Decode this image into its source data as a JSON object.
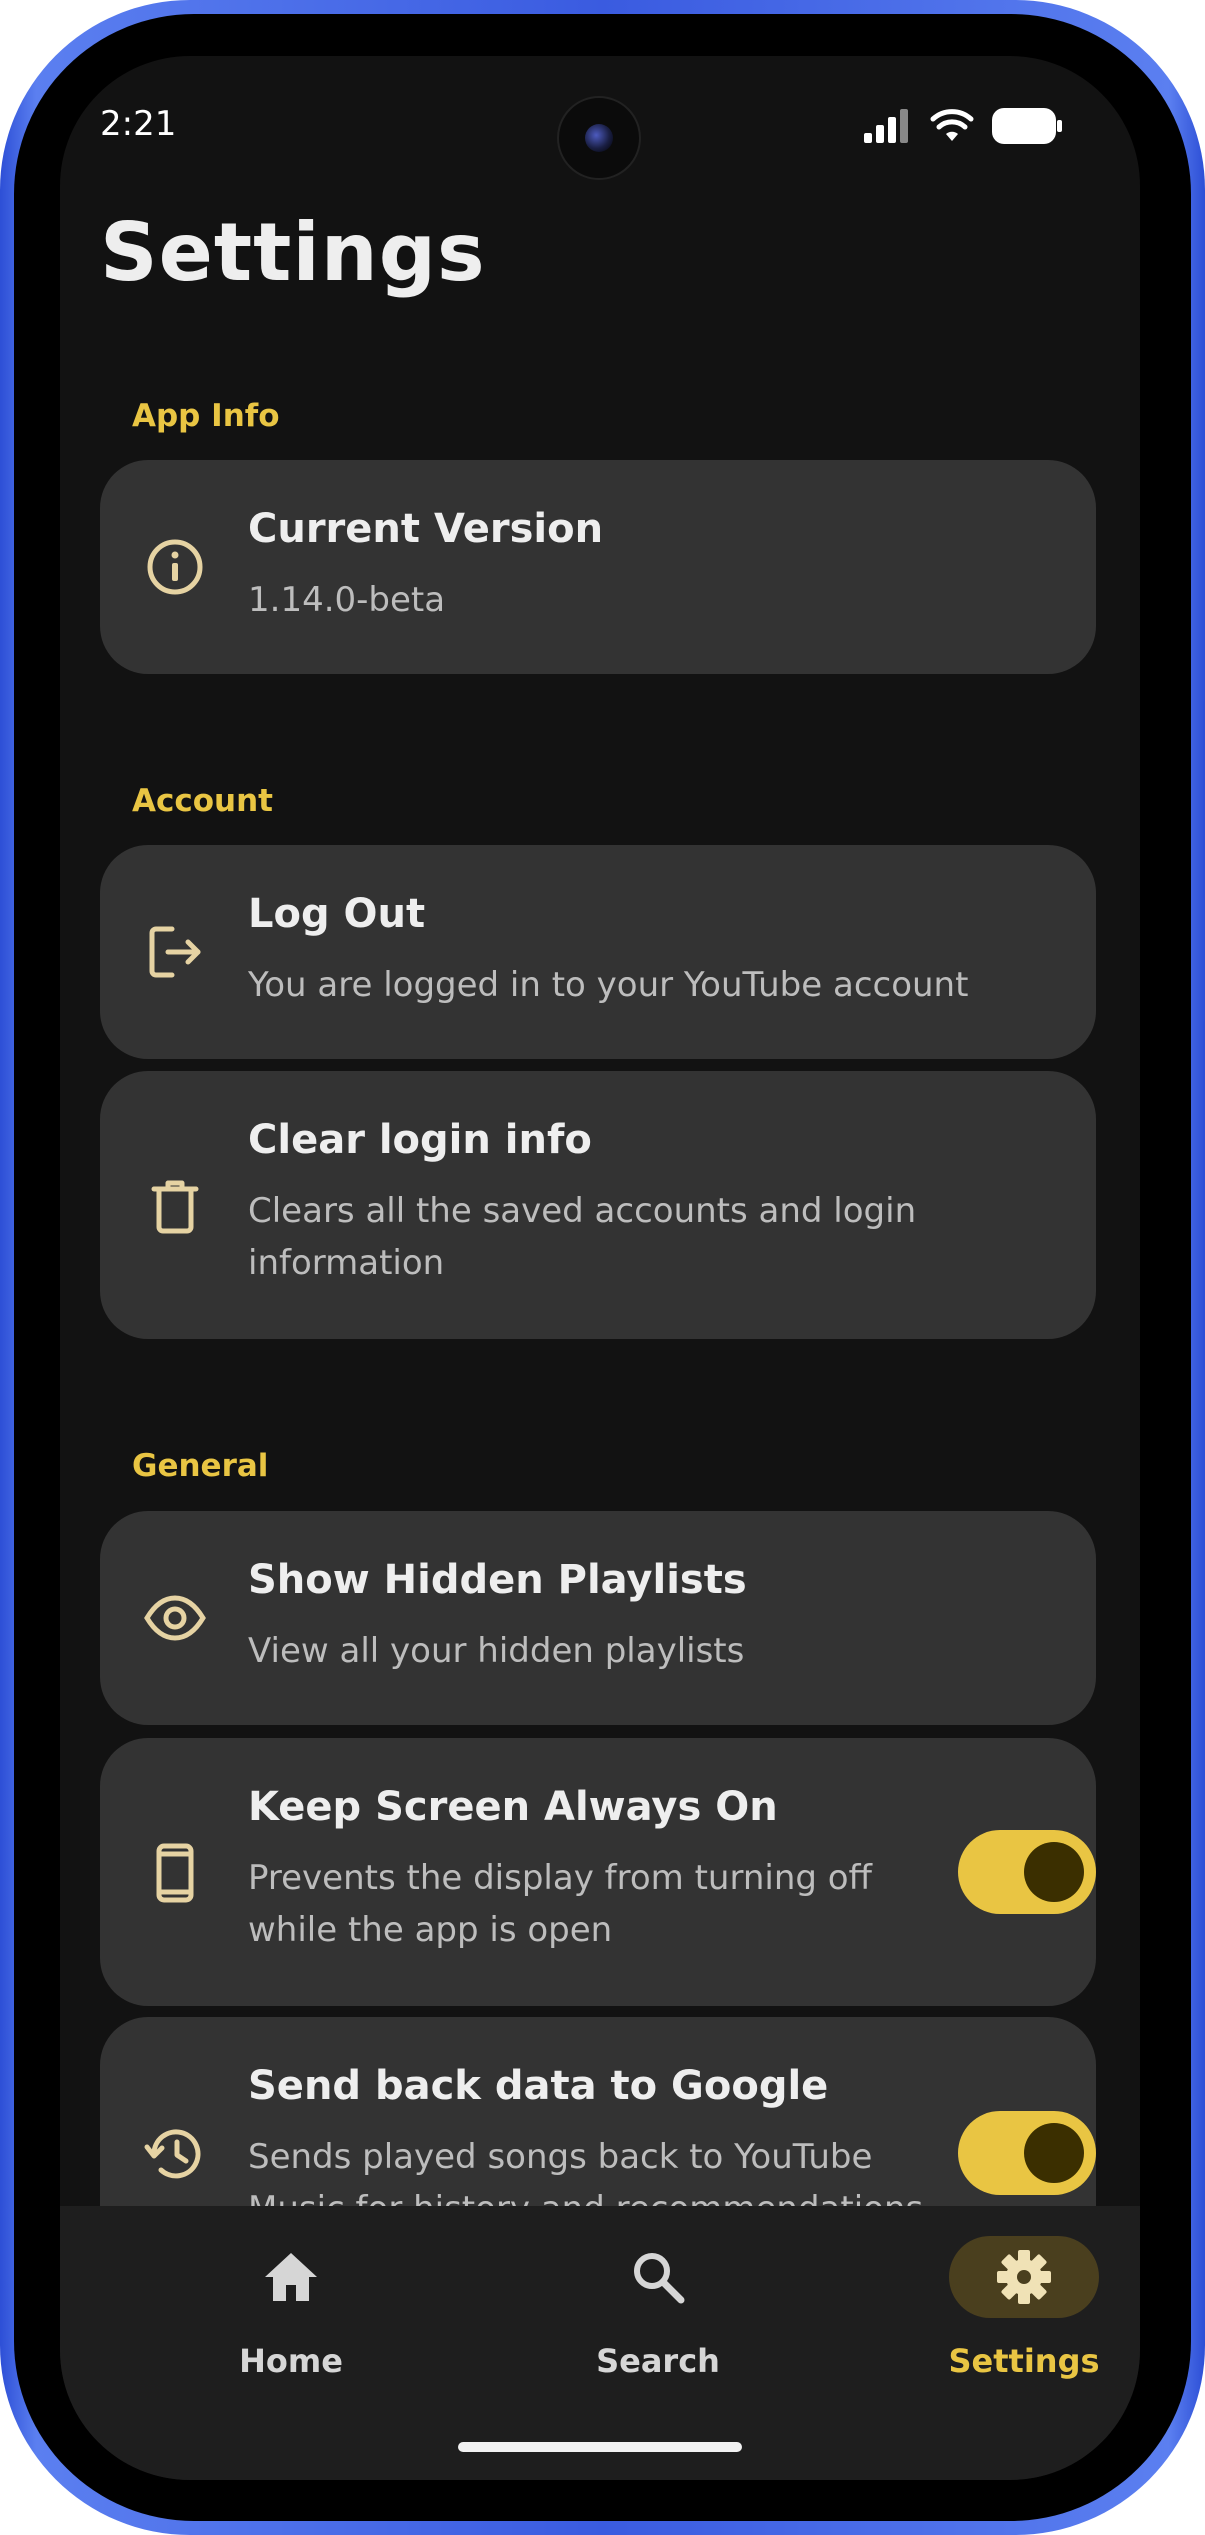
{
  "status_bar": {
    "time": "2:21"
  },
  "page": {
    "title": "Settings"
  },
  "sections": {
    "app_info": {
      "label": "App Info",
      "current_version": {
        "title": "Current Version",
        "subtitle": "1.14.0-beta"
      }
    },
    "account": {
      "label": "Account",
      "log_out": {
        "title": "Log Out",
        "subtitle": "You are logged in to your YouTube account"
      },
      "clear_login": {
        "title": "Clear login info",
        "subtitle": "Clears all the saved accounts and login information"
      }
    },
    "general": {
      "label": "General",
      "hidden_playlists": {
        "title": "Show Hidden Playlists",
        "subtitle": "View all your hidden playlists"
      },
      "keep_screen_on": {
        "title": "Keep Screen Always On",
        "subtitle": "Prevents the display from turning off while the app is open",
        "enabled": true
      },
      "send_data": {
        "title": "Send back data to Google",
        "subtitle": "Sends played songs back to YouTube Music for history and recommendations",
        "enabled": true
      }
    }
  },
  "bottom_nav": {
    "items": [
      {
        "label": "Home",
        "icon": "home-icon",
        "active": false
      },
      {
        "label": "Search",
        "icon": "search-icon",
        "active": false
      },
      {
        "label": "Settings",
        "icon": "gear-icon",
        "active": true
      }
    ]
  },
  "colors": {
    "accent": "#e9c543",
    "background": "#121212",
    "card": "#333333",
    "frame": "#3a5be0"
  }
}
